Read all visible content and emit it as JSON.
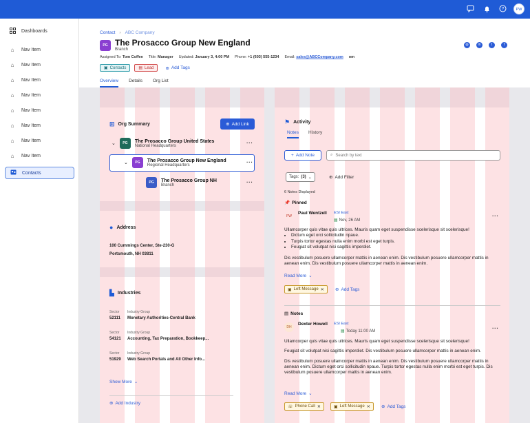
{
  "topbar": {
    "icons": [
      "chat-icon",
      "bell-icon",
      "help-icon"
    ],
    "user_initials": "PW"
  },
  "sidebar": {
    "items": [
      {
        "label": "Dashboards",
        "icon": "grid-icon"
      },
      {
        "label": "Nav Item",
        "icon": "nav-icon"
      },
      {
        "label": "Nav Item",
        "icon": "home-icon"
      },
      {
        "label": "Nav Item",
        "icon": "home-icon"
      },
      {
        "label": "Nav Item",
        "icon": "home-icon"
      },
      {
        "label": "Nav Item",
        "icon": "home-icon"
      },
      {
        "label": "Nav Item",
        "icon": "home-icon"
      },
      {
        "label": "Nav Item",
        "icon": "home-icon"
      },
      {
        "label": "Nav Item",
        "icon": "home-icon"
      },
      {
        "label": "Contacts",
        "icon": "contact-card-icon",
        "active": true
      }
    ]
  },
  "header": {
    "breadcrumb": {
      "root": "Contact",
      "current": "ABC Company"
    },
    "avatar": "PG",
    "title": "The Prosacco Group New England",
    "subtitle": "Branch",
    "meta": {
      "assigned_label": "Assigned To:",
      "assigned_value": "Tom Coffee",
      "title_label": "Title:",
      "title_value": "Manager",
      "updated_label": "Updated:",
      "updated_value": "January 3, 4:00 PM",
      "phone_label": "Phone:",
      "phone_value": "+1 (603) 555-1234",
      "email_label": "Email:",
      "email_value": "sales@ABCCompany.com",
      "extra": "om"
    },
    "tags": {
      "contacts": "Contacts",
      "lead": "Lead",
      "add_tags": "Add Tags"
    },
    "tabs": [
      "Overview",
      "Details",
      "Org List"
    ]
  },
  "org_summary": {
    "title": "Org Summary",
    "add_link": "Add Link",
    "nodes": [
      {
        "initials": "PG",
        "name": "The Prosacco Group United States",
        "desc": "National Headquarters",
        "color": "#1f6b5a"
      },
      {
        "initials": "PG",
        "name": "The Prosacco Group New England",
        "desc": "Regional Headquarters",
        "color": "#8a3fd1"
      },
      {
        "initials": "PG",
        "name": "The Prosacco Group NH",
        "desc": "Branch",
        "color": "#3a5bc7"
      }
    ]
  },
  "address": {
    "title": "Address",
    "line1": "100 Cummings Center, Ste-230-G",
    "line2": "Portsmouth, NH 03811"
  },
  "industries": {
    "title": "Industries",
    "col_sector": "Sector",
    "col_group": "Industry Group",
    "rows": [
      {
        "code": "52111",
        "desc": "Monetary Authorities-Central Bank"
      },
      {
        "code": "54121",
        "desc": "Accounting, Tax Preparation, Bookkeep..."
      },
      {
        "code": "51929",
        "desc": "Web Search Portals and All Other Info..."
      }
    ],
    "show_more": "Show More",
    "add_industry": "Add Industry"
  },
  "activity": {
    "title": "Activity",
    "tabs": [
      "Notes",
      "History"
    ],
    "add_note": "Add Note",
    "search_placeholder": "Search by text",
    "tags_filter": "Tags:",
    "tags_count": "(3)",
    "add_filter": "Add Filter",
    "notes_displayed": "6 Notes Displayed",
    "pinned_label": "Pinned",
    "notes_label": "Notes",
    "pinned_note": {
      "initials": "PW",
      "author": "Paul Wentzell",
      "team": "ESI East",
      "date": "Nov, 26 AM",
      "p1": "Ullamcorper quis vitae quis ultrices. Mauris quam eget suspendisse scelerisque sit scelerisque!",
      "bullets": [
        "Dictum eget orci sollicitudin npaue.",
        "Turpis tortor egestas nulla enim morbi est eget turpis.",
        "Feugiat sit volutpat nisi sagittis imperdiet."
      ],
      "p2": "Dis vestibulum posuere ullamcorper mattis in aenean enim. Dis vestibulum posuere ullamcorper mattis in aenean enim. Dis vestibulum posuere ullamcorper mattis in aenean enim.",
      "read_more": "Read More",
      "tags": [
        "Left Message"
      ],
      "add_tags": "Add Tags"
    },
    "note2": {
      "initials": "DH",
      "author": "Dexter Howell",
      "team": "ESI East",
      "date": "Today 11:00 AM",
      "p1": "Ullamcorper quis vitae quis ultrices. Mauris quam eget suspendisse scelerisque sit scelerisque!",
      "p2": "Feugiat sit volutpat nisi sagittis imperdiet.  Dis vestibulum posuere ullamcorper mattis in aenean enim.",
      "p3": "Dis vestibulum posuere ullamcorper mattis in aenean enim. Dis vestibulum posuere ullamcorper mattis in aenean enim. Dictum eget orci sollicitudin npaue. Turpis tortor egestas nulla enim morbi est eget turpis. Dis vestibulum posuere ullamcorper mattis in aenean enim.",
      "read_more": "Read More",
      "tags": [
        "Phone Call",
        "Left Message"
      ],
      "add_tags": "Add Tags"
    }
  }
}
